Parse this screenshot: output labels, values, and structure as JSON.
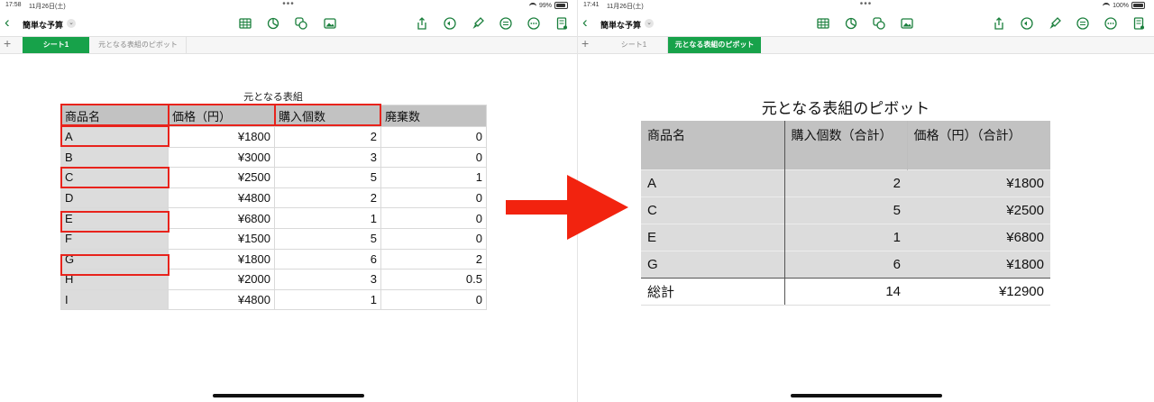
{
  "left": {
    "status": {
      "time": "17:58",
      "date": "11月26日(土)",
      "battery": "99%",
      "dots": "•••"
    },
    "toolbar": {
      "back": "‹",
      "title": "簡単な予算",
      "chevron": "⌄"
    },
    "tabs": [
      {
        "label": "シート1"
      },
      {
        "label": "元となる表組のピボット"
      }
    ],
    "add_sheet": "+",
    "table_title": "元となる表組",
    "table": {
      "headers": [
        "商品名",
        "価格（円）",
        "購入個数",
        "廃棄数"
      ],
      "rows": [
        [
          "A",
          "¥1800",
          "2",
          "0"
        ],
        [
          "B",
          "¥3000",
          "3",
          "0"
        ],
        [
          "C",
          "¥2500",
          "5",
          "1"
        ],
        [
          "D",
          "¥4800",
          "2",
          "0"
        ],
        [
          "E",
          "¥6800",
          "1",
          "0"
        ],
        [
          "F",
          "¥1500",
          "5",
          "0"
        ],
        [
          "G",
          "¥1800",
          "6",
          "2"
        ],
        [
          "H",
          "¥2000",
          "3",
          "0.5"
        ],
        [
          "I",
          "¥4800",
          "1",
          "0"
        ]
      ]
    }
  },
  "right": {
    "status": {
      "time": "17:41",
      "date": "11月26日(土)",
      "battery": "100%",
      "dots": "•••"
    },
    "toolbar": {
      "back": "‹",
      "title": "簡単な予算",
      "chevron": "⌄"
    },
    "tabs": [
      {
        "label": "シート1"
      },
      {
        "label": "元となる表組のピボット"
      }
    ],
    "add_sheet": "+",
    "pivot_title": "元となる表組のピボット",
    "pivot": {
      "headers": [
        "商品名",
        "購入個数（合計）",
        "価格（円）（合計）"
      ],
      "rows": [
        [
          "A",
          "2",
          "¥1800"
        ],
        [
          "C",
          "5",
          "¥2500"
        ],
        [
          "E",
          "1",
          "¥6800"
        ],
        [
          "G",
          "6",
          "¥1800"
        ]
      ],
      "total": [
        "総計",
        "14",
        "¥12900"
      ]
    }
  },
  "colors": {
    "accent_green": "#17a24a",
    "highlight_red": "#e8231c",
    "arrow_red": "#f2230f"
  },
  "icons": [
    "table-icon",
    "chart-icon",
    "shapes-icon",
    "media-icon",
    "share-icon",
    "undo-icon",
    "format-brush-icon",
    "collaborate-icon",
    "more-icon",
    "document-icon"
  ]
}
